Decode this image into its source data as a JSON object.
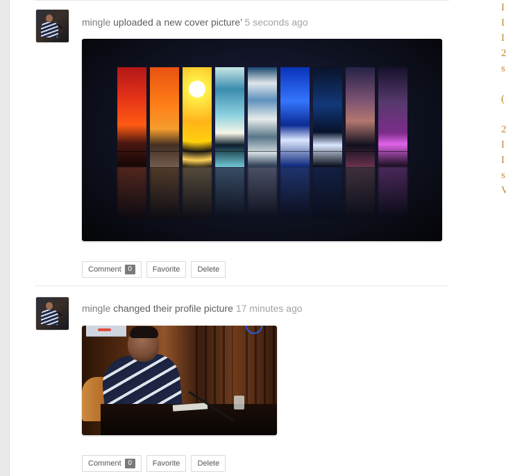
{
  "colors": {
    "page_background": "#ffffff",
    "left_rail": "#e9e9e9",
    "muted_text": "#7d7d7d",
    "action_text": "#5e5e5e",
    "timestamp_text": "#a3a3a3",
    "button_border": "#d9d9d9",
    "badge_background": "#7a7a7a",
    "right_edge_text": "#c28a2c"
  },
  "feed": {
    "items": [
      {
        "avatar_icon": "user-avatar-icon",
        "actor": "mingle",
        "action": "uploaded a new cover picture’",
        "time": "5 seconds ago",
        "image_icon": "cover-photo-image",
        "buttons": {
          "comment": "Comment",
          "comment_count": "0",
          "favorite": "Favorite",
          "delete": "Delete"
        }
      },
      {
        "avatar_icon": "user-avatar-icon",
        "actor": "mingle",
        "action": "changed their profile picture",
        "time": "17 minutes ago",
        "image_icon": "profile-photo-image",
        "buttons": {
          "comment": "Comment",
          "comment_count": "0",
          "favorite": "Favorite",
          "delete": "Delete"
        }
      }
    ]
  },
  "right_edge": {
    "partial_glyphs": [
      "I",
      "I",
      "I",
      "2",
      "s",
      "",
      "(",
      "",
      "2",
      "I",
      "I",
      "s",
      "V"
    ]
  }
}
